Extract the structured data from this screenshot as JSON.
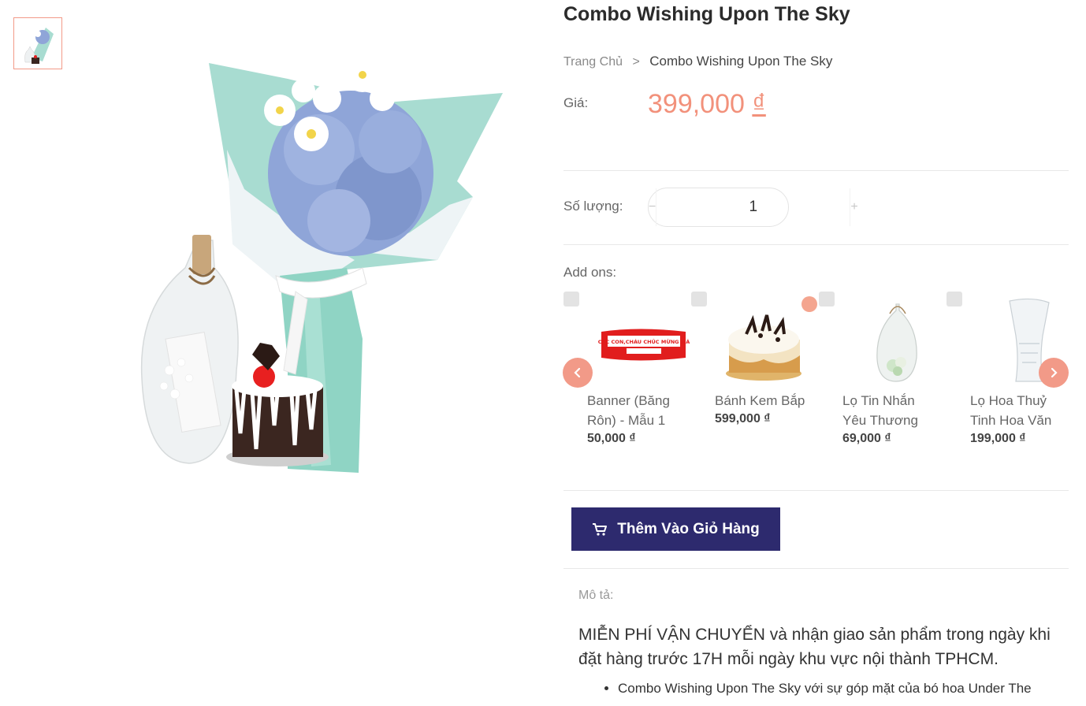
{
  "product": {
    "title": "Combo Wishing Upon The Sky",
    "breadcrumb": {
      "home": "Trang Chủ",
      "separator": ">",
      "current": "Combo Wishing Upon The Sky"
    },
    "price_label": "Giá:",
    "price_amount": "399,000",
    "price_currency": "₫",
    "quantity_label": "Số lượng:",
    "quantity_value": "1",
    "minus_symbol": "−",
    "plus_symbol": "+"
  },
  "addons": {
    "label": "Add ons:",
    "items": [
      {
        "name": "Banner (Băng Rôn) - Mẫu 1",
        "price": "50,000 ₫",
        "banner_text": "CÁC CON,CHÁU CHÚC MỪNG MÁ"
      },
      {
        "name": "Bánh Kem Bắp",
        "price": "599,000 ₫"
      },
      {
        "name": "Lọ Tin Nhắn Yêu Thương",
        "price": "69,000 ₫"
      },
      {
        "name": "Lọ Hoa Thuỷ Tinh Hoa Văn",
        "price": "199,000 ₫"
      }
    ],
    "prev_icon": "chevron-left-icon",
    "next_icon": "chevron-right-icon"
  },
  "cart_button": {
    "label": "Thêm Vào Giỏ Hàng",
    "icon": "cart-icon"
  },
  "description": {
    "label": "Mô tả:",
    "headline": "MIỄN PHÍ VẬN CHUYỂN và nhận giao sản phẩm trong ngày khi đặt hàng trước 17H mỗi ngày khu vực nội thành TPHCM.",
    "bullets": [
      "Combo Wishing Upon The Sky với sự góp mặt của bó hoa Under The"
    ]
  },
  "colors": {
    "accent": "#f2917b",
    "button": "#2d2a6e",
    "wrap": "#a8dcd1",
    "hydrangea": "#8fa5d8"
  }
}
